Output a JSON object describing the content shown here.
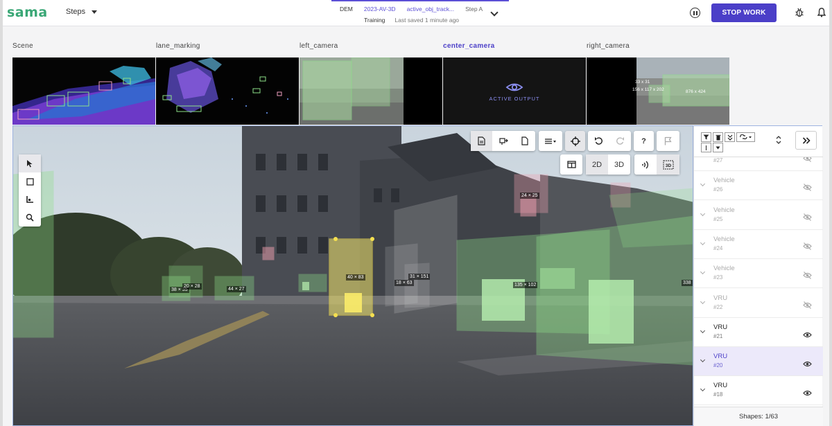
{
  "app": {
    "logo": "sama",
    "steps_label": "Steps",
    "stop_button": "STOP WORK"
  },
  "breadcrumb": {
    "project": "DEM",
    "batch": "2023-AV-3D",
    "task": "active_obj_track...",
    "step": "Step A",
    "mode": "Training",
    "saved": "Last saved 1 minute ago"
  },
  "cameras": [
    {
      "label": "Scene",
      "active": false
    },
    {
      "label": "lane_marking",
      "active": false
    },
    {
      "label": "left_camera",
      "active": false
    },
    {
      "label": "center_camera",
      "active": true
    },
    {
      "label": "right_camera",
      "active": false
    }
  ],
  "active_output_text": "ACTIVE OUTPUT",
  "thumb_labels": {
    "right_a": "33 x 31",
    "right_b": "156 x 117 x 202",
    "right_c": "876 x 424"
  },
  "toolbar": {
    "view_2d": "2D",
    "view_3d": "3D",
    "help": "?",
    "badge_3d": "3D"
  },
  "box_labels": {
    "b1": "24 × 25",
    "b2": "38 × 35",
    "b3": "20 × 28",
    "b4": "44 × 27",
    "b5": "40 × 83",
    "b6": "18 × 63",
    "b7": "31 × 151",
    "b8": "135 × 102",
    "b9": "338"
  },
  "shapes": [
    {
      "name": "",
      "id": "#27",
      "faded": true,
      "visible": false
    },
    {
      "name": "Vehicle",
      "id": "#26",
      "faded": true,
      "visible": false
    },
    {
      "name": "Vehicle",
      "id": "#25",
      "faded": true,
      "visible": false
    },
    {
      "name": "Vehicle",
      "id": "#24",
      "faded": true,
      "visible": false
    },
    {
      "name": "Vehicle",
      "id": "#23",
      "faded": true,
      "visible": false
    },
    {
      "name": "VRU",
      "id": "#22",
      "faded": true,
      "visible": false
    },
    {
      "name": "VRU",
      "id": "#21",
      "faded": false,
      "visible": true
    },
    {
      "name": "VRU",
      "id": "#20",
      "faded": false,
      "visible": true,
      "selected": true
    },
    {
      "name": "VRU",
      "id": "#18",
      "faded": false,
      "visible": true
    }
  ],
  "shapes_count": "Shapes: 1/63"
}
